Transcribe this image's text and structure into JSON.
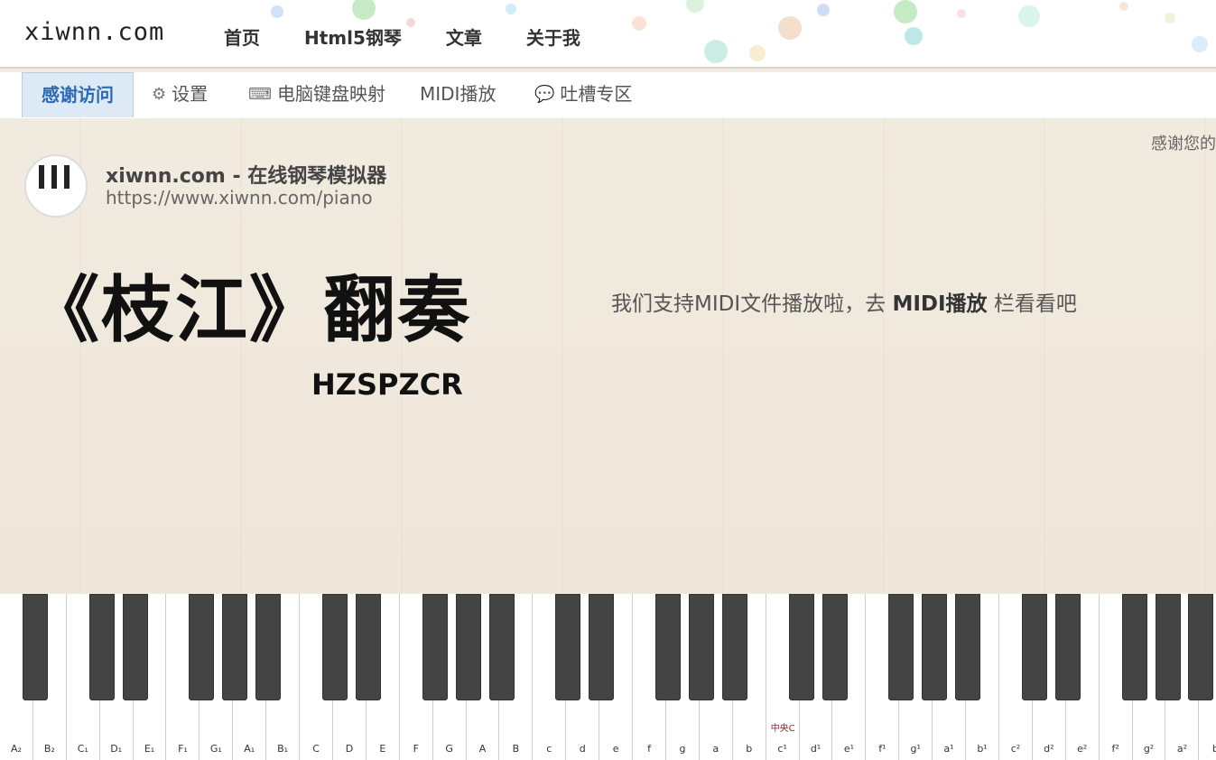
{
  "header": {
    "brand": "xiwnn.com",
    "nav": [
      "首页",
      "Html5钢琴",
      "文章",
      "关于我"
    ]
  },
  "tabs": [
    {
      "label": "感谢访问",
      "icon": "",
      "active": true
    },
    {
      "label": "设置",
      "icon": "gear-icon"
    },
    {
      "label": "电脑键盘映射",
      "icon": "keyboard-icon"
    },
    {
      "label": "MIDI播放",
      "icon": ""
    },
    {
      "label": "吐槽专区",
      "icon": "chat-bubble-icon"
    }
  ],
  "main": {
    "thanks_text": "感谢您的",
    "site_title": "xiwnn.com - 在线钢琴模拟器",
    "site_url": "https://www.xiwnn.com/piano",
    "song_title": "《枝江》翻奏",
    "author": "HZSPZCR",
    "midi_note_prefix": "我们支持MIDI文件播放啦，去 ",
    "midi_note_link": "MIDI播放",
    "midi_note_suffix": " 栏看看吧"
  },
  "piano": {
    "middle_c_label": "中央C",
    "white_keys": [
      "A₂",
      "B₂",
      "C₁",
      "D₁",
      "E₁",
      "F₁",
      "G₁",
      "A₁",
      "B₁",
      "C",
      "D",
      "E",
      "F",
      "G",
      "A",
      "B",
      "c",
      "d",
      "e",
      "f",
      "g",
      "a",
      "b",
      "c¹",
      "d¹",
      "e¹",
      "f¹",
      "g¹",
      "a¹",
      "b¹",
      "c²",
      "d²",
      "e²",
      "f²",
      "g²",
      "a²",
      "b"
    ]
  },
  "colors": {
    "active_tab": "#2a6bb4",
    "black_key": "#444444"
  }
}
